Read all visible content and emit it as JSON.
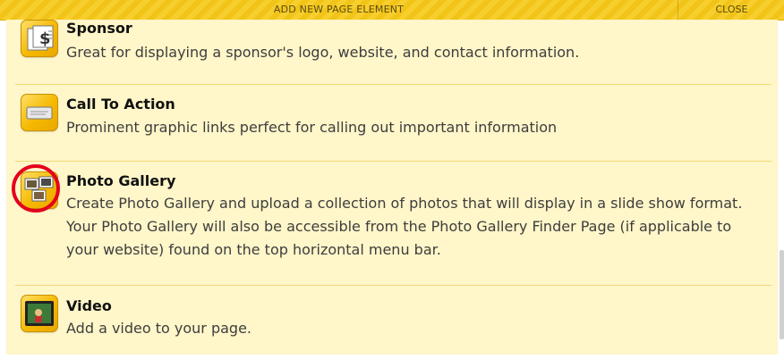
{
  "header": {
    "title": "ADD NEW PAGE ELEMENT",
    "close_label": "CLOSE"
  },
  "elements": [
    {
      "name": "Sponsor",
      "icon": "sponsor-dollar-icon",
      "description": [
        "Great for displaying a sponsor's logo, website, and contact information."
      ]
    },
    {
      "name": "Call To Action",
      "icon": "call-to-action-icon",
      "description": [
        "Prominent graphic links perfect for calling out important information"
      ]
    },
    {
      "name": "Photo Gallery",
      "icon": "photo-gallery-icon",
      "description": [
        "Create Photo Gallery and upload a collection of photos that will display in a slide show format.",
        "Your Photo Gallery will also be accessible from the Photo Gallery Finder Page (if applicable to",
        "your website) found on the top horizontal menu bar."
      ]
    },
    {
      "name": "Video",
      "icon": "video-icon",
      "description": [
        "Add a video to your page."
      ]
    }
  ],
  "colors": {
    "header_yellow": "#f7cf2d",
    "panel_bg": "#fff6c9",
    "highlight_red": "#e5001c"
  }
}
